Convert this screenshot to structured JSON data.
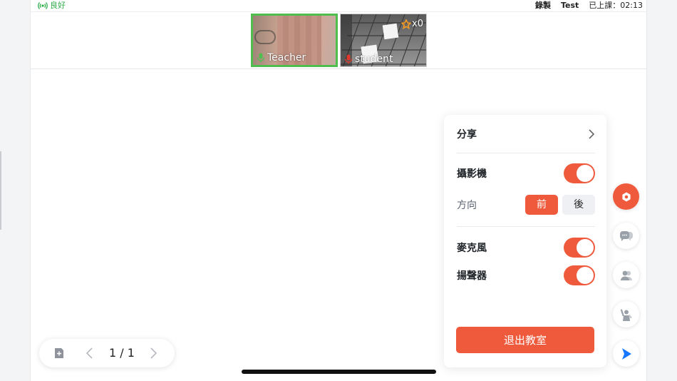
{
  "status": {
    "network_label": "良好",
    "record_label": "錄製",
    "test_label": "Test",
    "class_time": "已上課：02:13"
  },
  "videos": [
    {
      "name": "Teacher",
      "mic": "on",
      "active": true
    },
    {
      "name": "student",
      "mic": "muted",
      "stars": "x0"
    }
  ],
  "panel": {
    "share_label": "分享",
    "camera_label": "攝影機",
    "camera_on": true,
    "direction_label": "方向",
    "direction_front": "前",
    "direction_back": "後",
    "direction_selected": "前",
    "microphone_label": "麥克風",
    "microphone_on": true,
    "speaker_label": "揚聲器",
    "speaker_on": true,
    "exit_label": "退出教室"
  },
  "rail": {
    "items": [
      "settings-icon",
      "chat-icon",
      "members-icon",
      "raise-hand-icon",
      "pointer-icon"
    ],
    "active": "settings-icon"
  },
  "pager": {
    "page_text": "1 / 1"
  },
  "colors": {
    "accent": "#ef5a3d",
    "network_good": "#2fae4a",
    "speaking_border": "#4fbe4f",
    "pointer_blue": "#1677ff"
  }
}
